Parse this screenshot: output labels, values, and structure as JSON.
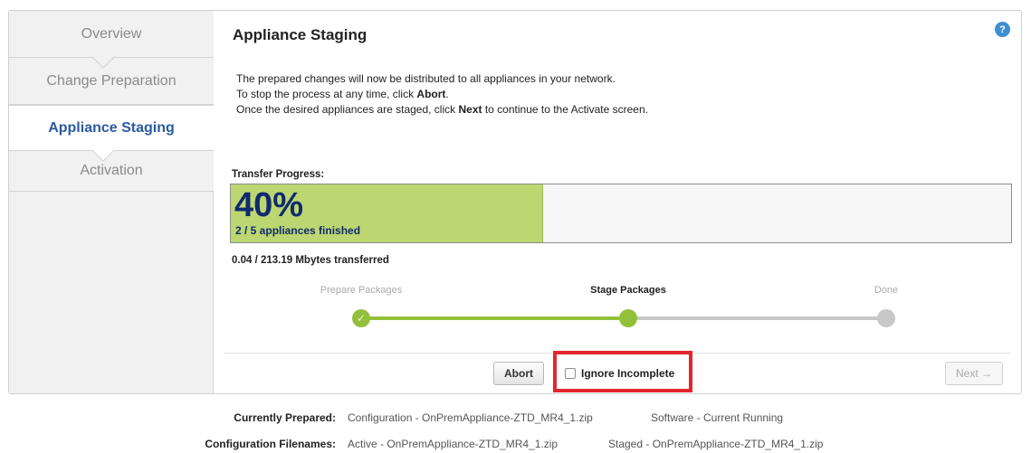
{
  "sidebar": {
    "items": [
      {
        "label": "Overview"
      },
      {
        "label": "Change Preparation"
      },
      {
        "label": "Appliance Staging"
      },
      {
        "label": "Activation"
      }
    ]
  },
  "header": {
    "title": "Appliance Staging",
    "help_icon": "?"
  },
  "description": {
    "line1": "The prepared changes will now be distributed to all appliances in your network.",
    "line2_pre": "To stop the process at any time, click ",
    "line2_bold": "Abort",
    "line2_post": ".",
    "line3_pre": "Once the desired appliances are staged, click ",
    "line3_bold": "Next",
    "line3_post": " to continue to the Activate screen."
  },
  "progress": {
    "label": "Transfer Progress:",
    "percent_text": "40%",
    "fraction": 0.4,
    "finished_text": "2 / 5 appliances finished",
    "transferred_text": "0.04 / 213.19 Mbytes transferred"
  },
  "stages": {
    "items": [
      {
        "label": "Prepare Packages",
        "state": "done",
        "icon": "check-icon",
        "glyph": "✓"
      },
      {
        "label": "Stage Packages",
        "state": "current"
      },
      {
        "label": "Done",
        "state": "todo"
      }
    ]
  },
  "actions": {
    "abort_label": "Abort",
    "ignore_label": "Ignore Incomplete",
    "next_label": "Next →"
  },
  "footer": {
    "prepared_label": "Currently Prepared:",
    "prepared_config": "Configuration - OnPremAppliance-ZTD_MR4_1.zip",
    "prepared_software": "Software - Current Running",
    "filenames_label": "Configuration Filenames:",
    "active": "Active - OnPremAppliance-ZTD_MR4_1.zip",
    "staged": "Staged - OnPremAppliance-ZTD_MR4_1.zip"
  },
  "colors": {
    "accent": "#2a5aa0",
    "progress_fill": "#bcd671",
    "progress_text": "#102a6e",
    "stage_done": "#93c03b",
    "stage_todo": "#c8c8c8",
    "highlight": "#e3262e",
    "help": "#3d8fd1"
  }
}
